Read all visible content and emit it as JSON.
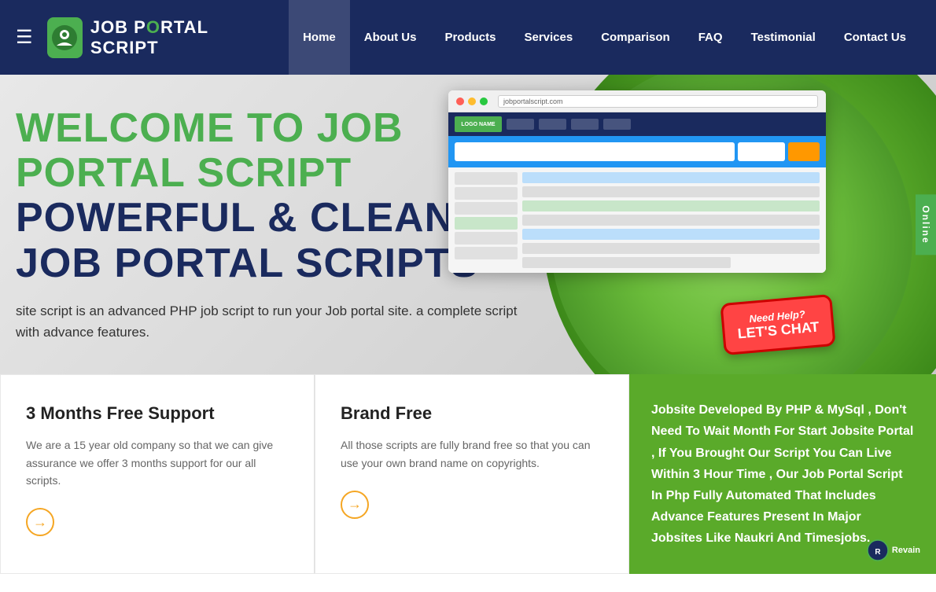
{
  "navbar": {
    "hamburger_label": "☰",
    "logo_text_part1": "JOB P",
    "logo_text_o": "O",
    "logo_text_part2": "RTAL SCRIPT",
    "nav_items": [
      {
        "label": "Home",
        "active": true
      },
      {
        "label": "About Us",
        "active": false
      },
      {
        "label": "Products",
        "active": false
      },
      {
        "label": "Services",
        "active": false
      },
      {
        "label": "Comparison",
        "active": false
      },
      {
        "label": "FAQ",
        "active": false
      },
      {
        "label": "Testimonial",
        "active": false
      },
      {
        "label": "Contact Us",
        "active": false
      }
    ]
  },
  "hero": {
    "title_welcome": "WELCOME TO JOB PORTAL SCRIPT",
    "title_powerful": "POWERFUL & CLEAN JOB PORTAL SCRIPTS",
    "subtitle": "site script is an advanced PHP job script to run your Job portal site.\na complete script with advance features.",
    "need_help_line1": "Need Help?",
    "need_help_line2": "LET'S CHAT",
    "online_label": "Online"
  },
  "cards": {
    "card1": {
      "title": "3 Months Free Support",
      "text": "We are a 15 year old company so that we can give assurance we offer 3 months support for our all scripts.",
      "arrow": "→"
    },
    "card2": {
      "title": "Brand Free",
      "text": "All those scripts are fully brand free so that you can use your own brand name on copyrights.",
      "arrow": "→"
    },
    "green_card": {
      "text": "Jobsite Developed By PHP & MySql , Don't Need To Wait Month For Start Jobsite Portal , If You Brought Our Script You Can Live Within 3 Hour Time , Our Job Portal Script In Php Fully Automated That Includes Advance Features Present In Major Jobsites Like Naukri And Timesjobs."
    }
  },
  "browser_mockup": {
    "url": "jobportalscript.com",
    "logo_label": "LOGO NAME"
  }
}
